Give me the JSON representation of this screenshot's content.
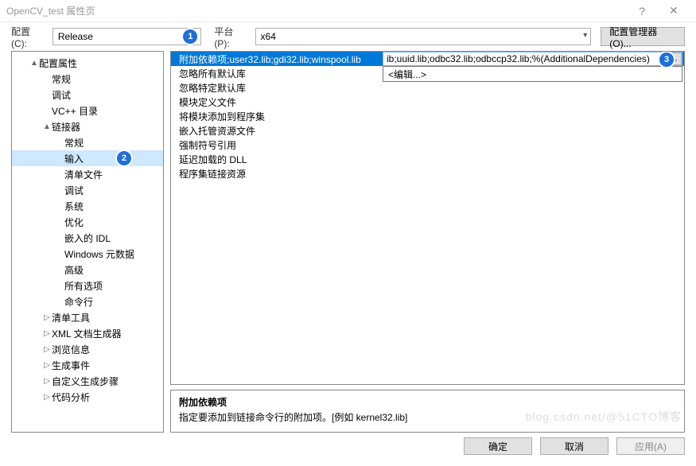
{
  "window": {
    "title": "OpenCV_test 属性页",
    "help_glyph": "?",
    "close_glyph": "✕"
  },
  "toolbar": {
    "config_label": "配置(C):",
    "config_value": "Release",
    "platform_label": "平台(P):",
    "platform_value": "x64",
    "config_manager_label": "配置管理器(O)..."
  },
  "tree": [
    {
      "label": "配置属性",
      "level": 1,
      "exp": "▲"
    },
    {
      "label": "常规",
      "level": 2
    },
    {
      "label": "调试",
      "level": 2
    },
    {
      "label": "VC++ 目录",
      "level": 2
    },
    {
      "label": "链接器",
      "level": 2,
      "exp": "▲"
    },
    {
      "label": "常规",
      "level": 3
    },
    {
      "label": "输入",
      "level": 3,
      "selected": true
    },
    {
      "label": "清单文件",
      "level": 3
    },
    {
      "label": "调试",
      "level": 3
    },
    {
      "label": "系统",
      "level": 3
    },
    {
      "label": "优化",
      "level": 3
    },
    {
      "label": "嵌入的 IDL",
      "level": 3
    },
    {
      "label": "Windows 元数据",
      "level": 3
    },
    {
      "label": "高级",
      "level": 3
    },
    {
      "label": "所有选项",
      "level": 3
    },
    {
      "label": "命令行",
      "level": 3
    },
    {
      "label": "清单工具",
      "level": 2,
      "exp": "▷"
    },
    {
      "label": "XML 文档生成器",
      "level": 2,
      "exp": "▷"
    },
    {
      "label": "浏览信息",
      "level": 2,
      "exp": "▷"
    },
    {
      "label": "生成事件",
      "level": 2,
      "exp": "▷"
    },
    {
      "label": "自定义生成步骤",
      "level": 2,
      "exp": "▷"
    },
    {
      "label": "代码分析",
      "level": 2,
      "exp": "▷"
    }
  ],
  "grid": {
    "rows": [
      {
        "name": "附加依赖项",
        "value_highlight": ";user32.lib;gdi32.lib;winspool.lib",
        "value_edit": "ib;uuid.lib;odbc32.lib;odbccp32.lib;%(AdditionalDependencies)",
        "selected": true
      },
      {
        "name": "忽略所有默认库",
        "value": ""
      },
      {
        "name": "忽略特定默认库",
        "value": ""
      },
      {
        "name": "模块定义文件",
        "value": ""
      },
      {
        "name": "将模块添加到程序集",
        "value": ""
      },
      {
        "name": "嵌入托管资源文件",
        "value": ""
      },
      {
        "name": "强制符号引用",
        "value": ""
      },
      {
        "name": "延迟加载的 DLL",
        "value": ""
      },
      {
        "name": "程序集链接资源",
        "value": ""
      }
    ],
    "dropdown_item": "<编辑...>"
  },
  "desc": {
    "title": "附加依赖项",
    "body": "指定要添加到链接命令行的附加项。[例如 kernel32.lib]"
  },
  "buttons": {
    "ok": "确定",
    "cancel": "取消",
    "apply": "应用(A)"
  },
  "badges": {
    "one": "1",
    "two": "2",
    "three": "3"
  },
  "watermark": "blog.csdn.net/@51CTO博客"
}
